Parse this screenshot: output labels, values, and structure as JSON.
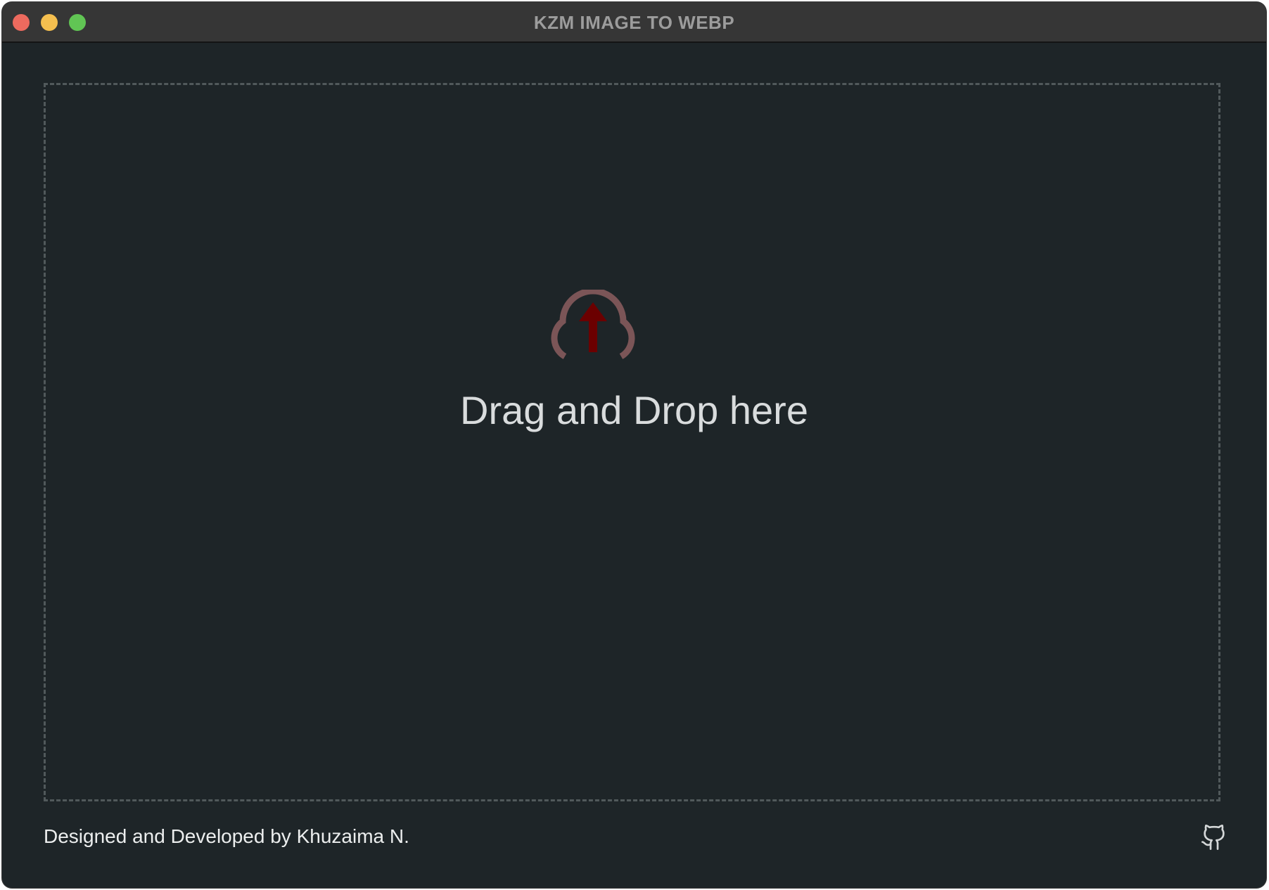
{
  "window": {
    "title": "KZM IMAGE TO WEBP",
    "traffic_lights": {
      "close_color": "#ed6a5e",
      "minimize_color": "#f5bf4f",
      "zoom_color": "#61c554"
    }
  },
  "dropzone": {
    "icon": "cloud-upload-icon",
    "icon_colors": {
      "cloud": "#7b5557",
      "arrow": "#6b0000"
    },
    "label": "Drag and Drop here"
  },
  "footer": {
    "credit": "Designed and Developed by Khuzaima N.",
    "icon": "github-icon"
  }
}
